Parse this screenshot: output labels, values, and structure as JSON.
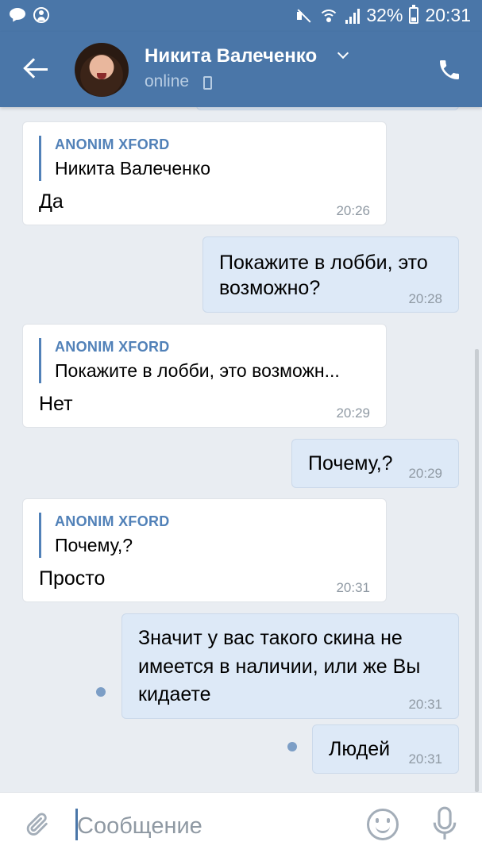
{
  "status_bar": {
    "battery": "32%",
    "time": "20:31"
  },
  "header": {
    "contact_name": "Никита Валеченко",
    "status": "online"
  },
  "messages": [
    {
      "direction": "in",
      "reply_author": "ANONIM XFORD",
      "reply_text": "Никита Валеченко",
      "text": "Да",
      "time": "20:26"
    },
    {
      "direction": "out",
      "text_lines": [
        "Покажите в лобби, это",
        "возможно?"
      ],
      "time": "20:28"
    },
    {
      "direction": "in",
      "reply_author": "ANONIM XFORD",
      "reply_text": "Покажите в лобби, это возможн...",
      "text": "Нет",
      "time": "20:29"
    },
    {
      "direction": "out",
      "text_lines": [
        "Почему,?"
      ],
      "time": "20:29"
    },
    {
      "direction": "in",
      "reply_author": "ANONIM XFORD",
      "reply_text": "Почему,?",
      "text": "Просто",
      "time": "20:31"
    },
    {
      "direction": "out",
      "text_lines": [
        "Значит у вас такого скина не",
        "имеется в наличии, или же Вы",
        "кидаете"
      ],
      "time": "20:31",
      "unread": true
    },
    {
      "direction": "out",
      "text_lines": [
        "Людей"
      ],
      "time": "20:31",
      "unread": true
    }
  ],
  "composer": {
    "placeholder": "Сообщение"
  },
  "colors": {
    "header": "#4a76a8",
    "accent": "#5181b8",
    "outgoing_bubble": "#dde9f7",
    "background": "#e9edf2"
  },
  "icons": [
    "chat-notification-icon",
    "account-icon",
    "mute-icon",
    "wifi-icon",
    "signal-icon",
    "battery-icon",
    "back-arrow-icon",
    "chevron-down-icon",
    "mobile-icon",
    "phone-call-icon",
    "paperclip-icon",
    "smiley-icon",
    "microphone-icon"
  ]
}
